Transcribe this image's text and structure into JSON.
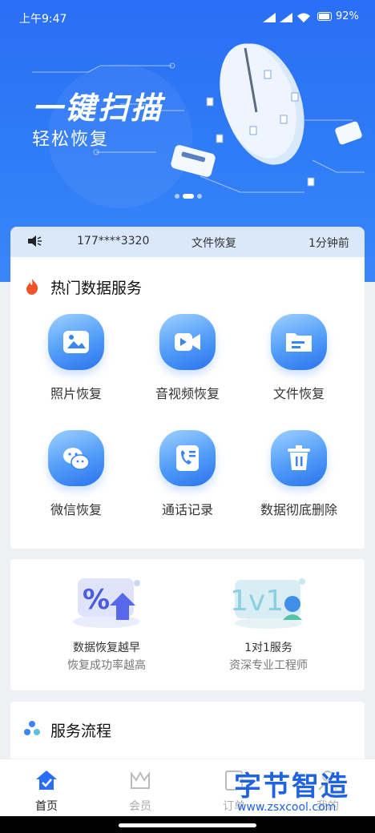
{
  "status_bar": {
    "time": "上午9:47",
    "battery": "92"
  },
  "banner": {
    "title": "一键扫描",
    "subtitle": "轻松恢复"
  },
  "ticker": {
    "phone": "177****3320",
    "action": "文件恢复",
    "ago": "1分钟前"
  },
  "hot_services": {
    "title": "热门数据服务",
    "items": [
      {
        "label": "照片恢复",
        "icon": "photo-icon"
      },
      {
        "label": "音视频恢复",
        "icon": "video-icon"
      },
      {
        "label": "文件恢复",
        "icon": "folder-icon"
      },
      {
        "label": "微信恢复",
        "icon": "wechat-icon"
      },
      {
        "label": "通话记录",
        "icon": "phone-contact-icon"
      },
      {
        "label": "数据彻底删除",
        "icon": "trash-icon"
      }
    ]
  },
  "promos": [
    {
      "line1": "数据恢复越早",
      "line2": "恢复成功率越高",
      "art": "percent-up-icon"
    },
    {
      "line1": "1对1服务",
      "line2": "资深专业工程师",
      "art": "1v1-engineer-icon"
    }
  ],
  "process": {
    "title": "服务流程"
  },
  "tabs": [
    {
      "label": "首页",
      "active": true
    },
    {
      "label": "会员",
      "active": false
    },
    {
      "label": "订单",
      "active": false
    },
    {
      "label": "我的",
      "active": false
    }
  ],
  "watermark": {
    "name": "字节智造",
    "url": "www.zsxcool.com"
  },
  "colors": {
    "primary": "#2a6ef5",
    "ticker_bg": "#dbe7fb",
    "fire": "#f0532a"
  }
}
